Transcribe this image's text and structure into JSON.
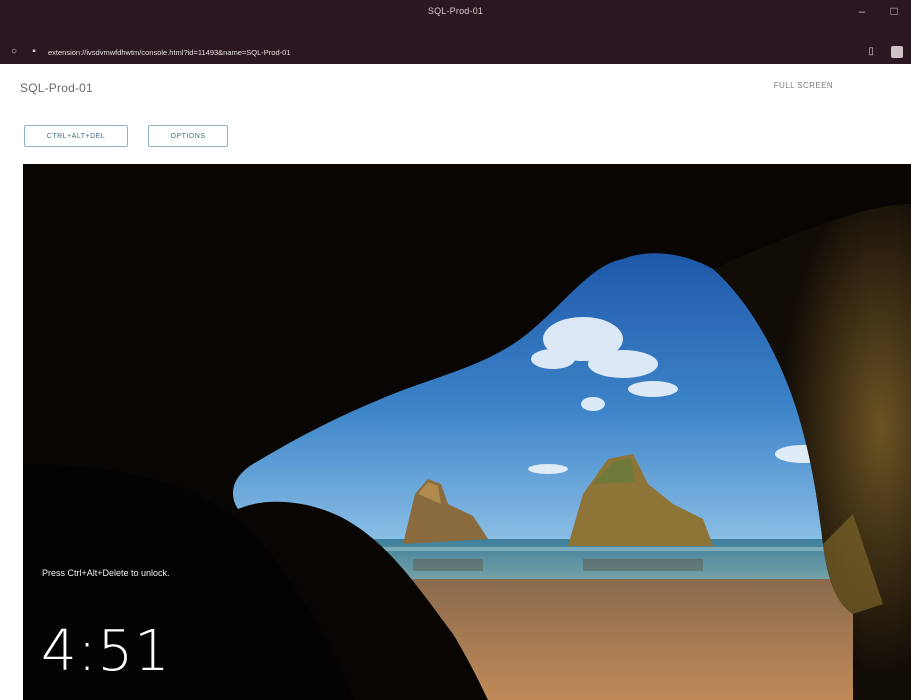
{
  "browser": {
    "window_title": "SQL-Prod-01",
    "url": "extension://ivsdvmwfdhwtm/console.html?id=11493&name=SQL-Prod-01",
    "icons": [
      "shield-icon",
      "lock-icon",
      "minimize-icon",
      "maximize-icon",
      "bookmark-icon",
      "extension-icon"
    ]
  },
  "console": {
    "vm_name": "SQL-Prod-01",
    "fullscreen_label": "FULL SCREEN",
    "buttons": {
      "ctrl_alt_del": "CTRL+ALT+DEL",
      "options": "OPTIONS"
    }
  },
  "lockscreen": {
    "message": "Press Ctrl+Alt+Delete to unlock.",
    "time": "4:51"
  },
  "colors": {
    "chrome_bg": "#2b1722",
    "button_border": "#8fb3c4",
    "button_text": "#3f6f86",
    "sky": "#2f6fb8",
    "sand": "#b58152"
  }
}
